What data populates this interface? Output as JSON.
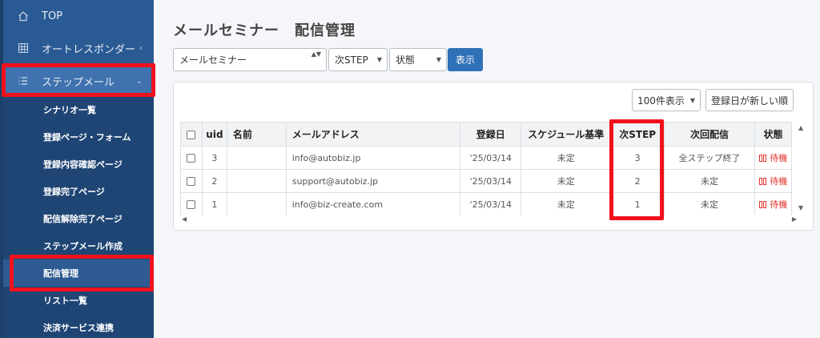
{
  "sidebar": {
    "top_label": "TOP",
    "autoresponder_label": "オートレスポンダー",
    "stepmail_label": "ステップメール",
    "submenu": [
      "シナリオ一覧",
      "登録ページ・フォーム",
      "登録内容確認ページ",
      "登録完了ページ",
      "配信解除完了ページ",
      "ステップメール作成",
      "配信管理",
      "リスト一覧",
      "決済サービス連携"
    ],
    "active_submenu": "配信管理"
  },
  "main": {
    "title": "メールセミナー　配信管理",
    "filters": {
      "scenario": "メールセミナー",
      "next_step": "次STEP",
      "state": "状態",
      "show_button": "表示"
    },
    "per_page": "100件表示",
    "sort": "登録日が新しい順"
  },
  "table": {
    "headers": [
      "uid",
      "名前",
      "メールアドレス",
      "登録日",
      "スケジュール基準",
      "次STEP",
      "次回配信",
      "状態"
    ],
    "rows": [
      {
        "uid": "3",
        "name": "",
        "email": "info@autobiz.jp",
        "date": "'25/03/14",
        "schedule": "未定",
        "next_step": "3",
        "next_delivery": "全ステップ終了",
        "status": "待機"
      },
      {
        "uid": "2",
        "name": "",
        "email": "support@autobiz.jp",
        "date": "'25/03/14",
        "schedule": "未定",
        "next_step": "2",
        "next_delivery": "未定",
        "status": "待機"
      },
      {
        "uid": "1",
        "name": "",
        "email": "info@biz-create.com",
        "date": "'25/03/14",
        "schedule": "未定",
        "next_step": "1",
        "next_delivery": "未定",
        "status": "待機"
      }
    ]
  },
  "colors": {
    "sidebar": "#2a5a94",
    "submenu": "#1e4574",
    "highlight": "#f0121c",
    "primary_button": "#2f71b8",
    "status_red": "#e0302a"
  }
}
